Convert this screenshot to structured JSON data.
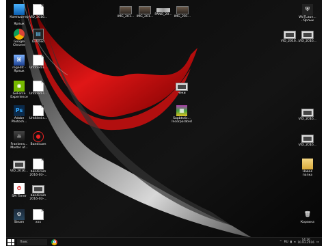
{
  "desktop": {
    "icons_left": [
      {
        "label": "Компьютер -\nЯрлык",
        "icon": "computer-icon"
      },
      {
        "label": "Google\nChrome",
        "icon": "chrome-icon"
      },
      {
        "label": "regedit -\nЯрлык",
        "icon": "regedit-icon"
      },
      {
        "label": "GeForce\nExperience",
        "icon": "geforce-icon"
      },
      {
        "label": "Adobe\nPhotosh...",
        "icon": "photoshop-icon"
      },
      {
        "label": "Frankens...\nMaster of...",
        "icon": "game-icon"
      },
      {
        "label": "VID_2016...",
        "icon": "video-file-icon"
      },
      {
        "label": "SM Timer",
        "icon": "timer-icon"
      },
      {
        "label": "Steam",
        "icon": "steam-icon"
      }
    ],
    "icons_col2": [
      {
        "label": "VID_2016...",
        "icon": "document-icon"
      },
      {
        "label": "Untitled",
        "icon": "dark-file-icon"
      },
      {
        "label": "Untitled.s...",
        "icon": "document-icon"
      },
      {
        "label": "Untitled.s...",
        "icon": "document-icon"
      },
      {
        "label": "Untitled.s...",
        "icon": "document-icon"
      },
      {
        "label": "Bandicam",
        "icon": "bandicam-icon"
      },
      {
        "label": "bandicam\n2016-03-...",
        "icon": "document-icon"
      },
      {
        "label": "bandicam\n2016-03-...",
        "icon": "video-file-icon"
      },
      {
        "label": "xxx",
        "icon": "document-icon"
      }
    ],
    "icons_top": [
      {
        "label": "IMG_201...",
        "icon": "image-file-icon"
      },
      {
        "label": "IMG_201...",
        "icon": "image-file-icon"
      },
      {
        "label": "PANO_20...",
        "icon": "panorama-file-icon"
      },
      {
        "label": "IMG_201...",
        "icon": "image-file-icon"
      }
    ],
    "icons_middle": [
      {
        "label": "чеки",
        "icon": "video-file-icon"
      },
      {
        "label": "Sapbtstic...\nIncorporated",
        "icon": "archive-icon"
      }
    ],
    "icons_right": [
      {
        "label": "WoTLaun...\n- Ярлык",
        "icon": "wot-icon"
      },
      {
        "label": "VID_2016...",
        "icon": "video-file-icon"
      },
      {
        "label": "VID_2016...",
        "icon": "video-file-icon"
      },
      {
        "label": "VID_2016...",
        "icon": "video-file-icon"
      },
      {
        "label": "Новая\nпапка",
        "icon": "folder-icon"
      },
      {
        "label": "Корзина",
        "icon": "recycle-bin-icon"
      }
    ]
  },
  "taskbar": {
    "search_placeholder": "Поис",
    "tray": {
      "lang": "RU",
      "time": "14:20",
      "date": "10.03.2016"
    }
  },
  "colors": {
    "accent_red": "#d81818",
    "taskbar": "#101010"
  }
}
